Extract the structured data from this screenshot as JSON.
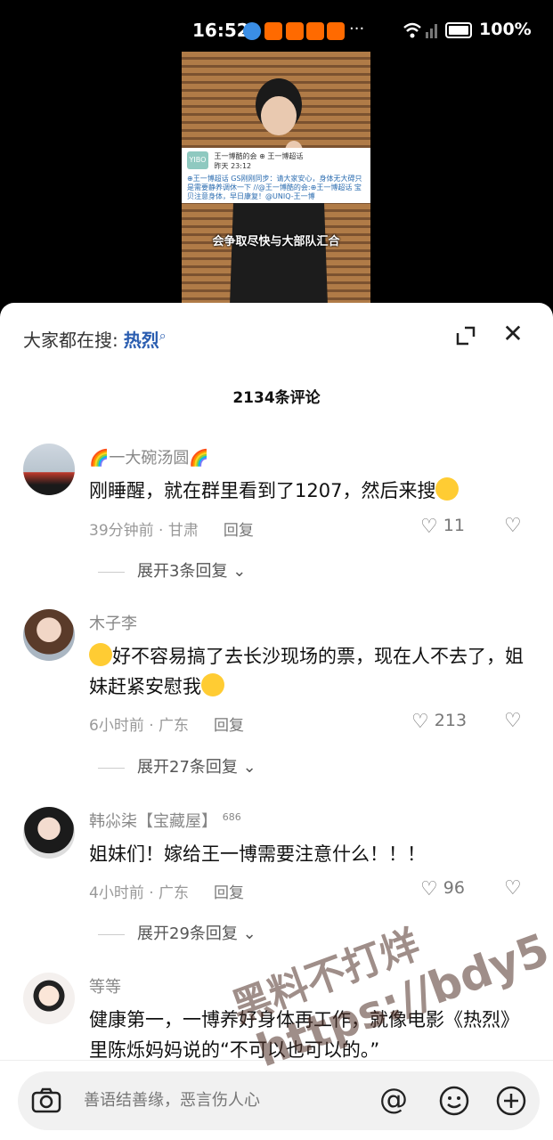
{
  "status_bar": {
    "time": "16:52",
    "more": "···",
    "battery": "100%"
  },
  "video": {
    "weibo_card": {
      "logo": "YIBO",
      "account": "王一博酷的会 ⊕ 王一博超话",
      "date": "昨天 23:12",
      "text": "⊕王一博超话 GS刚刚同步：请大家安心，身体无大碍只是需要静养调休一下 //@王一博酷的会:⊕王一博超话 宝贝注意身体，早日康复！@UNIQ-王一博"
    },
    "caption": "会争取尽快与大部队汇合"
  },
  "sheet": {
    "search_prefix": "大家都在搜:",
    "search_keyword": "热烈",
    "comment_count": "2134条评论",
    "comments": [
      {
        "username": "🌈一大碗汤圆🌈",
        "text": "刚睡醒，就在群里看到了1207，然后来搜",
        "meta": "39分钟前 · 甘肃",
        "reply": "回复",
        "likes": "11",
        "expand": "展开3条回复"
      },
      {
        "username": "木子李",
        "text": "好不容易搞了去长沙现场的票，现在人不去了，姐妹赶紧安慰我",
        "meta": "6小时前 · 广东",
        "reply": "回复",
        "likes": "213",
        "expand": "展开27条回复"
      },
      {
        "username": "韩尛柒【宝藏屋】",
        "badge": "686",
        "text": "姐妹们！嫁给王一博需要注意什么！！！",
        "meta": "4小时前 · 广东",
        "reply": "回复",
        "likes": "96",
        "expand": "展开29条回复"
      },
      {
        "username": "等等",
        "text": "健康第一，一博养好身体再工作，就像电影《热烈》里陈烁妈妈说的“不可以也可以的。”"
      }
    ]
  },
  "input": {
    "placeholder": "善语结善缘，恶言伤人心",
    "at": "@"
  },
  "watermark": {
    "line1": "黑料不打烊",
    "line2": "https://bdy5.co"
  }
}
